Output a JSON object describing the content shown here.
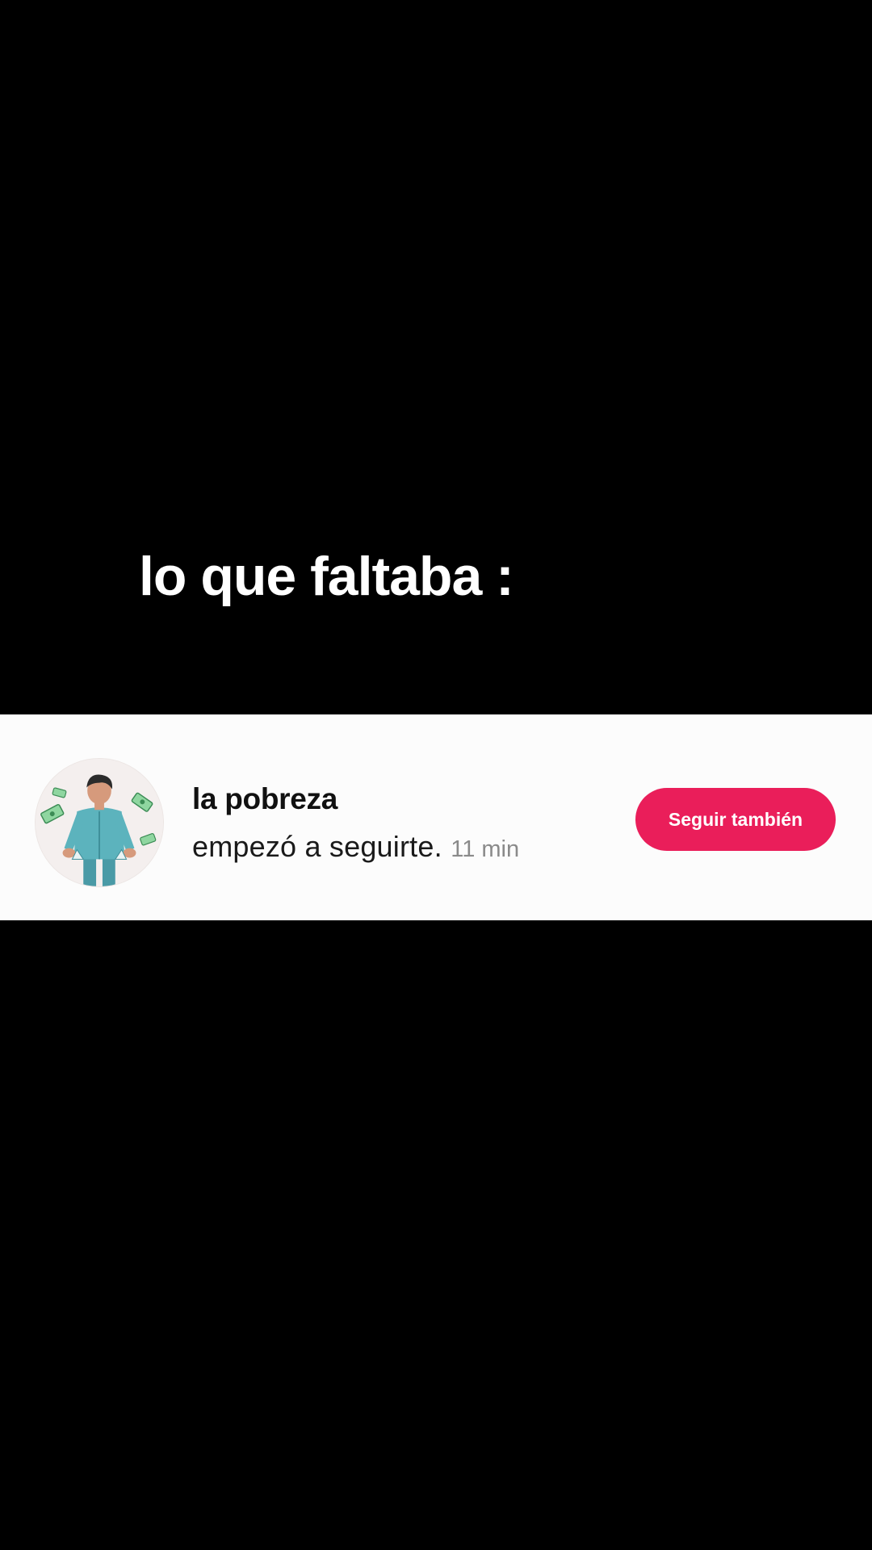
{
  "overlay": {
    "caption": "lo que faltaba :"
  },
  "notification": {
    "username": "la pobreza",
    "message": "empezó a seguirte.",
    "time": "11 min",
    "follow_back_label": "Seguir también",
    "avatar_icon": "person-empty-pockets-with-money-icon"
  },
  "colors": {
    "background": "#000000",
    "card": "#fcfcfc",
    "accent": "#ea1e5a",
    "timestamp": "#8a8a8a"
  }
}
